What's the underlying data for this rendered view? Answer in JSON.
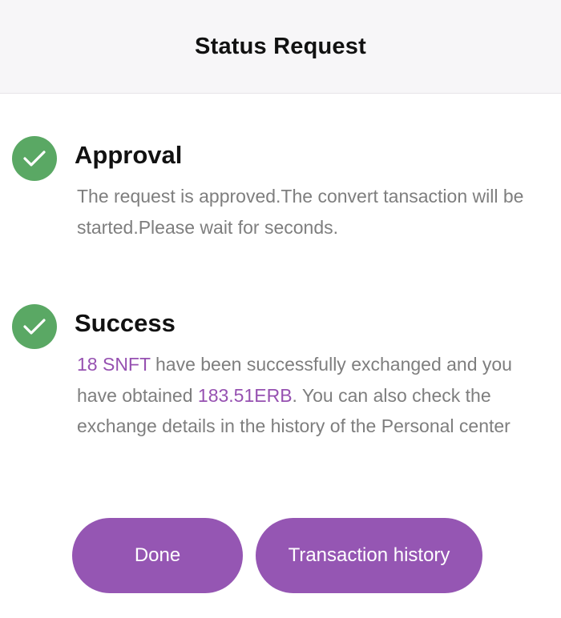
{
  "header": {
    "title": "Status Request"
  },
  "steps": {
    "approval": {
      "status_icon": "check-circle-icon",
      "title": "Approval",
      "description": "The request is approved.The convert tansaction will be started.Please wait for seconds."
    },
    "success": {
      "status_icon": "check-circle-icon",
      "title": "Success",
      "amount_snft": "18 SNFT",
      "text_part1": " have been successfully exchanged and you have obtained ",
      "amount_erb": "183.51ERB",
      "text_part2": ". You can also check the exchange details in the history of the Personal center"
    }
  },
  "actions": {
    "done_label": "Done",
    "history_label": "Transaction history"
  },
  "colors": {
    "accent": "#9556b3",
    "success_green": "#5aa864",
    "header_bg": "#f7f6f8",
    "muted_text": "#7e7e7e"
  }
}
